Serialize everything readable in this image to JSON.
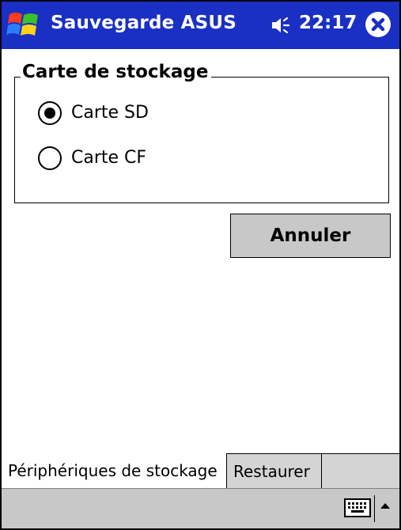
{
  "window": {
    "title": "Sauvegarde ASUS",
    "time": "22:17",
    "icons": {
      "start": "windows-flag-icon",
      "volume": "speaker-icon",
      "close": "close-icon"
    }
  },
  "storage_group": {
    "legend": "Carte de stockage",
    "options": [
      {
        "label": "Carte SD",
        "selected": true
      },
      {
        "label": "Carte CF",
        "selected": false
      }
    ]
  },
  "buttons": {
    "cancel": "Annuler"
  },
  "tabs": [
    {
      "label": "Périphériques de stockage",
      "active": true
    },
    {
      "label": "Restaurer",
      "active": false
    }
  ],
  "bottom_bar": {
    "icons": {
      "keyboard": "keyboard-icon",
      "menu": "arrow-up-icon"
    }
  },
  "colors": {
    "titlebar": "#1a2fc4",
    "button": "#c8c8c8",
    "tab_inactive": "#d4d4d4"
  }
}
